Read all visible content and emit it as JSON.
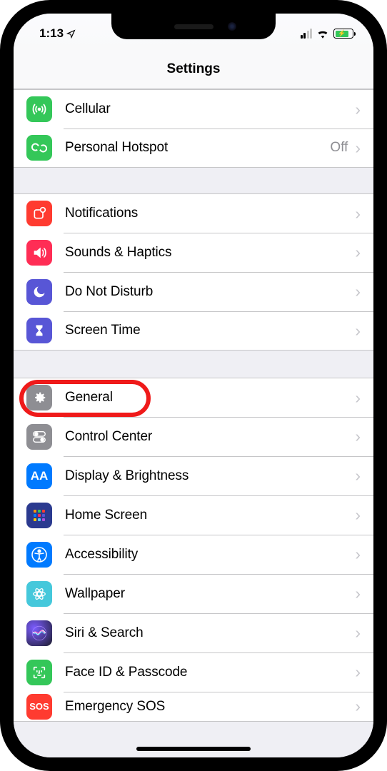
{
  "status_bar": {
    "time": "1:13"
  },
  "header": {
    "title": "Settings"
  },
  "groups": [
    {
      "rows": [
        {
          "id": "cellular",
          "label": "Cellular",
          "value": "",
          "icon": "antenna",
          "bg": "#34c759"
        },
        {
          "id": "personal-hotspot",
          "label": "Personal Hotspot",
          "value": "Off",
          "icon": "link",
          "bg": "#34c759"
        }
      ]
    },
    {
      "rows": [
        {
          "id": "notifications",
          "label": "Notifications",
          "value": "",
          "icon": "notification-square",
          "bg": "#ff3b30"
        },
        {
          "id": "sounds-haptics",
          "label": "Sounds & Haptics",
          "value": "",
          "icon": "speaker",
          "bg": "#ff2d55"
        },
        {
          "id": "do-not-disturb",
          "label": "Do Not Disturb",
          "value": "",
          "icon": "moon",
          "bg": "#5856d6"
        },
        {
          "id": "screen-time",
          "label": "Screen Time",
          "value": "",
          "icon": "hourglass",
          "bg": "#5856d6"
        }
      ]
    },
    {
      "rows": [
        {
          "id": "general",
          "label": "General",
          "value": "",
          "icon": "gear",
          "bg": "#8e8e93",
          "highlighted": true
        },
        {
          "id": "control-center",
          "label": "Control Center",
          "value": "",
          "icon": "toggles",
          "bg": "#8e8e93"
        },
        {
          "id": "display-brightness",
          "label": "Display & Brightness",
          "value": "",
          "icon": "text-aa",
          "bg": "#007aff"
        },
        {
          "id": "home-screen",
          "label": "Home Screen",
          "value": "",
          "icon": "grid",
          "bg": "#3a4aa8"
        },
        {
          "id": "accessibility",
          "label": "Accessibility",
          "value": "",
          "icon": "accessibility",
          "bg": "#007aff"
        },
        {
          "id": "wallpaper",
          "label": "Wallpaper",
          "value": "",
          "icon": "flower",
          "bg": "#45c8db"
        },
        {
          "id": "siri-search",
          "label": "Siri & Search",
          "value": "",
          "icon": "siri",
          "bg": "#1c1c1e"
        },
        {
          "id": "face-id-passcode",
          "label": "Face ID & Passcode",
          "value": "",
          "icon": "faceid",
          "bg": "#34c759"
        },
        {
          "id": "emergency-sos",
          "label": "Emergency SOS",
          "value": "",
          "icon": "sos-text",
          "bg": "#ff3b30"
        }
      ]
    }
  ]
}
